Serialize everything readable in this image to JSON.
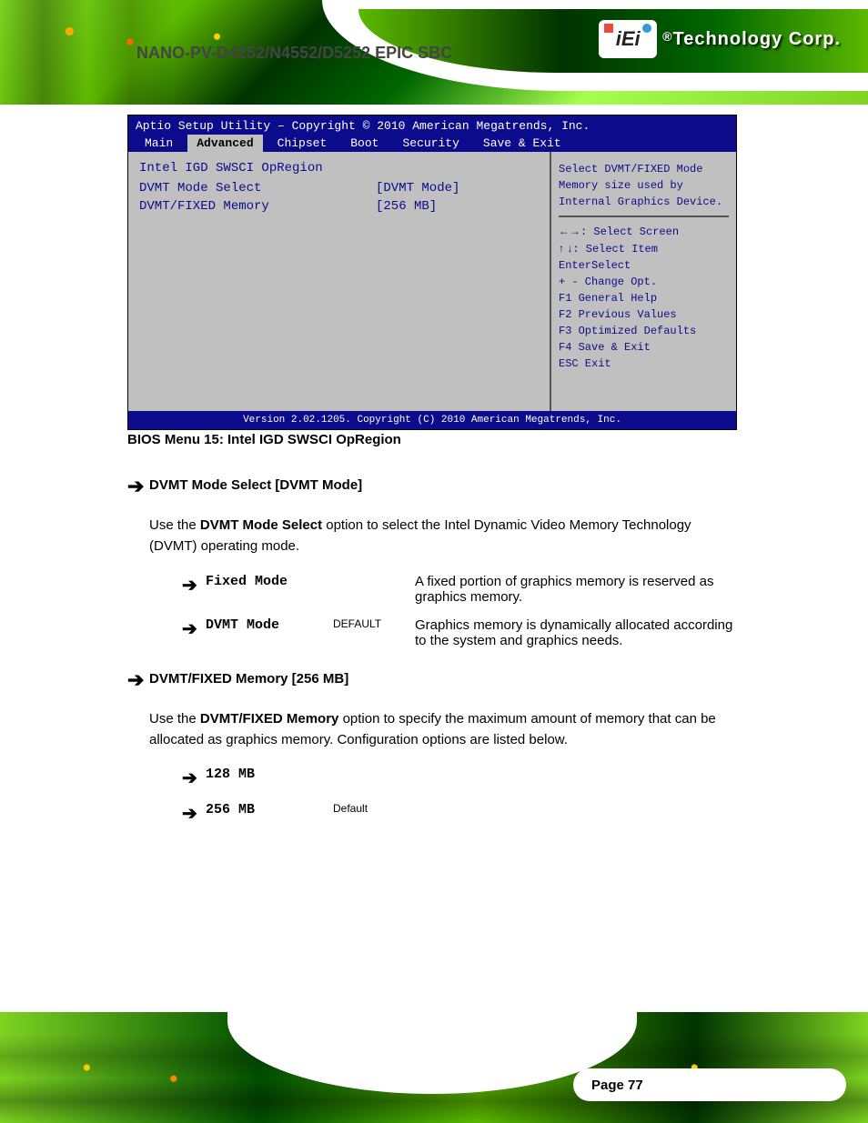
{
  "header": {
    "product": "NANO-PV-D4252/N4552/D5252 EPIC SBC",
    "brand_prefix": "®",
    "brand": "Technology Corp.",
    "logo_text": "iEi"
  },
  "bios": {
    "title": "Aptio Setup Utility – Copyright © 2010 American Megatrends, Inc.",
    "tabs": [
      "Main",
      "Advanced",
      "Chipset",
      "Boot",
      "Security",
      "Save & Exit"
    ],
    "active_tab": "Advanced",
    "section_title": "Intel IGD SWSCI OpRegion",
    "items": [
      {
        "label": "DVMT Mode Select",
        "value": "[DVMT Mode]"
      },
      {
        "label": "DVMT/FIXED Memory",
        "value": "[256 MB]"
      }
    ],
    "help": "Select DVMT/FIXED Mode Memory size used by Internal Graphics Device.",
    "legend": [
      {
        "icon": "lr",
        "text": ": Select Screen"
      },
      {
        "icon": "ud",
        "text": ": Select Item"
      },
      {
        "icon": "",
        "text": "EnterSelect"
      },
      {
        "icon": "",
        "text": "+  -    Change Opt."
      },
      {
        "icon": "",
        "text": "F1      General Help"
      },
      {
        "icon": "",
        "text": "F2      Previous Values"
      },
      {
        "icon": "",
        "text": "F3      Optimized Defaults"
      },
      {
        "icon": "",
        "text": "F4      Save & Exit"
      },
      {
        "icon": "",
        "text": "ESC     Exit"
      }
    ],
    "footer": "Version 2.02.1205. Copyright (C) 2010 American Megatrends, Inc."
  },
  "caption": "BIOS Menu 15: Intel IGD SWSCI OpRegion",
  "option1": {
    "title": "DVMT Mode Select [DVMT Mode]",
    "desc_before": "Use the ",
    "desc_bold": "DVMT Mode Select",
    "desc_after": " option to select the Intel Dynamic Video Memory Technology (DVMT) operating mode.",
    "rows": [
      {
        "label": "Fixed Mode",
        "default": "",
        "desc": "A fixed portion of graphics memory is reserved as graphics memory."
      },
      {
        "label": "DVMT Mode",
        "default": "DEFAULT",
        "desc": "Graphics memory is dynamically allocated according to the system and graphics needs."
      }
    ]
  },
  "option2": {
    "title": "DVMT/FIXED Memory [256 MB]",
    "desc_before": "Use the ",
    "desc_bold": "DVMT/FIXED Memory",
    "desc_after": " option to specify the maximum amount of memory that can be allocated as graphics memory. Configuration options are listed below.",
    "rows": [
      {
        "label": "128 MB",
        "default": "",
        "desc": ""
      },
      {
        "label": "256 MB",
        "default": "Default",
        "desc": ""
      }
    ]
  },
  "footer": {
    "page": "Page 77"
  }
}
